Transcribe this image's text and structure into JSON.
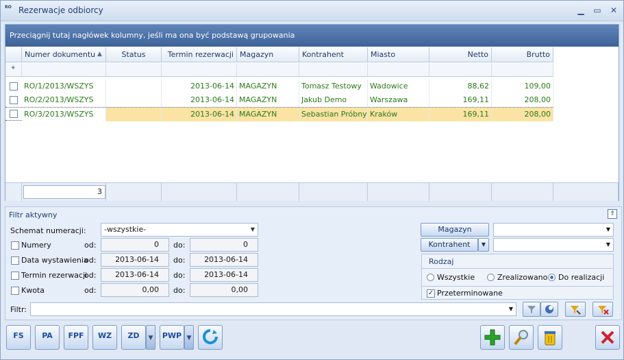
{
  "window": {
    "app_icon": "RO",
    "title": "Rezerwacje odbiorcy",
    "minimize": "▁",
    "maximize": "▭",
    "close": "✕"
  },
  "grid": {
    "group_panel": "Przeciągnij tutaj nagłówek kolumny, jeśli ma ona być podstawą grupowania",
    "columns": [
      "Numer dokumentu",
      "Status",
      "Termin rezerwacji",
      "Magazyn",
      "Kontrahent",
      "Miasto",
      "Netto",
      "Brutto"
    ],
    "sort_indicator": "▲",
    "rows": [
      {
        "numer": "RO/1/2013/WSZYS",
        "status": "",
        "termin": "2013-06-14",
        "magazyn": "MAGAZYN",
        "kontrahent": "Tomasz Testowy",
        "miasto": "Wadowice",
        "netto": "88,62",
        "brutto": "109,00"
      },
      {
        "numer": "RO/2/2013/WSZYS",
        "status": "",
        "termin": "2013-06-14",
        "magazyn": "MAGAZYN",
        "kontrahent": "Jakub Demo",
        "miasto": "Warszawa",
        "netto": "169,11",
        "brutto": "208,00"
      },
      {
        "numer": "RO/3/2013/WSZYS",
        "status": "",
        "termin": "2013-06-14",
        "magazyn": "MAGAZYN",
        "kontrahent": "Sebastian Próbny",
        "miasto": "Kraków",
        "netto": "169,11",
        "brutto": "208,00"
      }
    ],
    "count": "3"
  },
  "filter": {
    "title": "Filtr aktywny",
    "schemat_label": "Schemat numeracji:",
    "schemat_value": "-wszystkie-",
    "numery": {
      "label": "Numery",
      "od_label": "od:",
      "od": "0",
      "do_label": "do:",
      "do": "0"
    },
    "data_wystawienia": {
      "label": "Data wystawienia",
      "od_label": "od:",
      "od": "2013-06-14",
      "do_label": "do:",
      "do": "2013-06-14"
    },
    "termin_rezerwacji": {
      "label": "Termin rezerwacji",
      "od_label": "od:",
      "od": "2013-06-14",
      "do_label": "do:",
      "do": "2013-06-14"
    },
    "kwota": {
      "label": "Kwota",
      "od_label": "od:",
      "od": "0,00",
      "do_label": "do:",
      "do": "0,00"
    },
    "magazyn_button": "Magazyn",
    "kontrahent_button": "Kontrahent",
    "magazyn_value": "",
    "kontrahent_value": "",
    "rodzaj_title": "Rodzaj",
    "rodzaj_options": [
      "Wszystkie",
      "Zrealizowano",
      "Do realizacji"
    ],
    "rodzaj_selected": "Do realizacji",
    "przeterminowane": "Przeterminowane",
    "filtr_label": "Filtr:",
    "filtr_value": ""
  },
  "toolbar": {
    "fs": "FS",
    "pa": "PA",
    "fpf": "FPF",
    "wz": "WZ",
    "zd": "ZD",
    "pwp": "PWP"
  },
  "colors": {
    "accent": "#3d6399",
    "selected_row": "#fbe3a3",
    "text_green": "#2a7a1a"
  }
}
